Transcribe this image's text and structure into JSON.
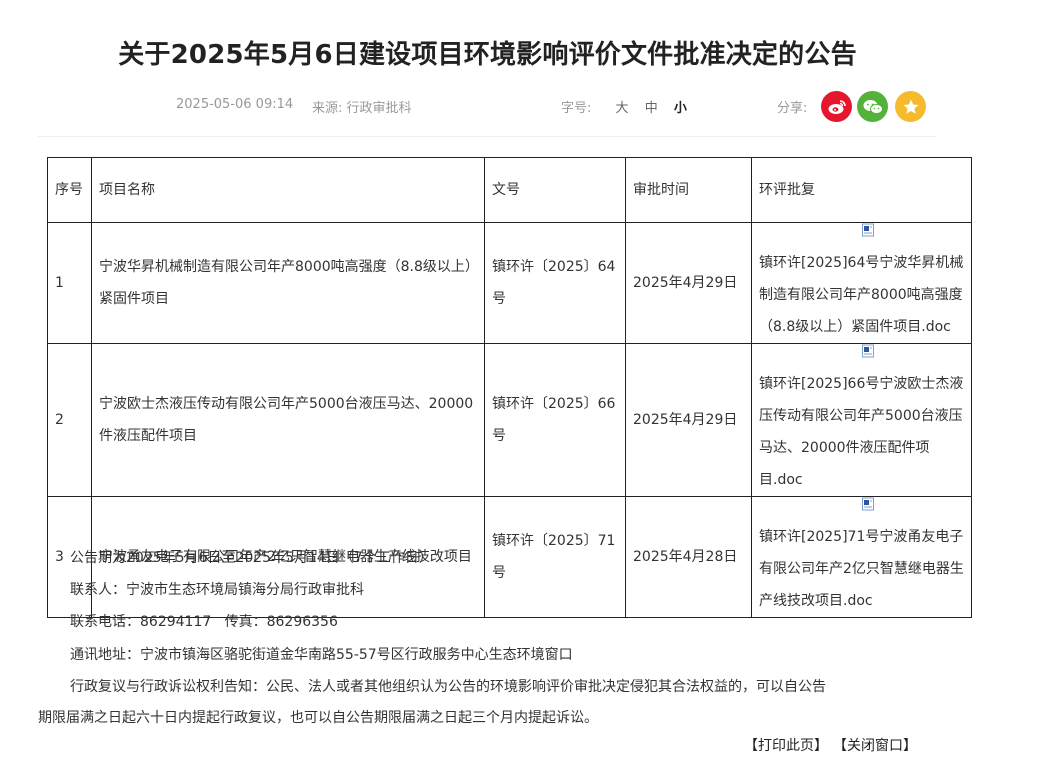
{
  "title": "关于2025年5月6日建设项目环境影响评价文件批准决定的公告",
  "meta": {
    "date": "2025-05-06 09:14",
    "source_label": "来源:",
    "source": "行政审批科",
    "font_size_label": "字号:",
    "font_sizes": [
      "大",
      "中",
      "小"
    ],
    "share_label": "分享:"
  },
  "share_icons": [
    "weibo-icon",
    "wechat-icon",
    "favorite-star-icon"
  ],
  "colors": {
    "weibo": "#e6162d",
    "wechat": "#52b23a",
    "favorite": "#f5bb2c"
  },
  "table": {
    "headers": {
      "seq": "序号",
      "name": "项目名称",
      "doc_no": "文号",
      "date": "审批时间",
      "reply": "环评批复"
    },
    "rows": [
      {
        "seq": "1",
        "name": "宁波华昇机械制造有限公司年产8000吨高强度（8.8级以上）紧固件项目",
        "doc_no": "镇环许〔2025〕64号",
        "date": "2025年4月29日",
        "file": "镇环许[2025]64号宁波华昇机械制造有限公司年产8000吨高强度（8.8级以上）紧固件项目.doc"
      },
      {
        "seq": "2",
        "name": "宁波欧士杰液压传动有限公司年产5000台液压马达、20000件液压配件项目",
        "doc_no": "镇环许〔2025〕66号",
        "date": "2025年4月29日",
        "file": "镇环许[2025]66号宁波欧士杰液压传动有限公司年产5000台液压马达、20000件液压配件项目.doc"
      },
      {
        "seq": "3",
        "name": "宁波甬友电子有限公司年产2亿只智慧继电器生产线技改项目",
        "doc_no": "镇环许〔2025〕71号",
        "date": "2025年4月28日",
        "file": "镇环许[2025]71号宁波甬友电子有限公司年产2亿只智慧继电器生产线技改项目.doc"
      }
    ]
  },
  "notice": {
    "period": "公告期为2025年5月6日至2025年5月14日（7个工作日）",
    "contact": "联系人：宁波市生态环境局镇海分局行政审批科",
    "phone": "联系电话：86294117   传真：86296356",
    "address": "通讯地址：宁波市镇海区骆驼街道金华南路55-57号区行政服务中心生态环境窗口",
    "rights_line1": "行政复议与行政诉讼权利告知：公民、法人或者其他组织认为公告的环境影响评价审批决定侵犯其合法权益的，可以自公告",
    "rights_line2": "期限届满之日起六十日内提起行政复议，也可以自公告期限届满之日起三个月内提起诉讼。"
  },
  "actions": {
    "print": "【打印此页】",
    "close": "【关闭窗口】"
  }
}
